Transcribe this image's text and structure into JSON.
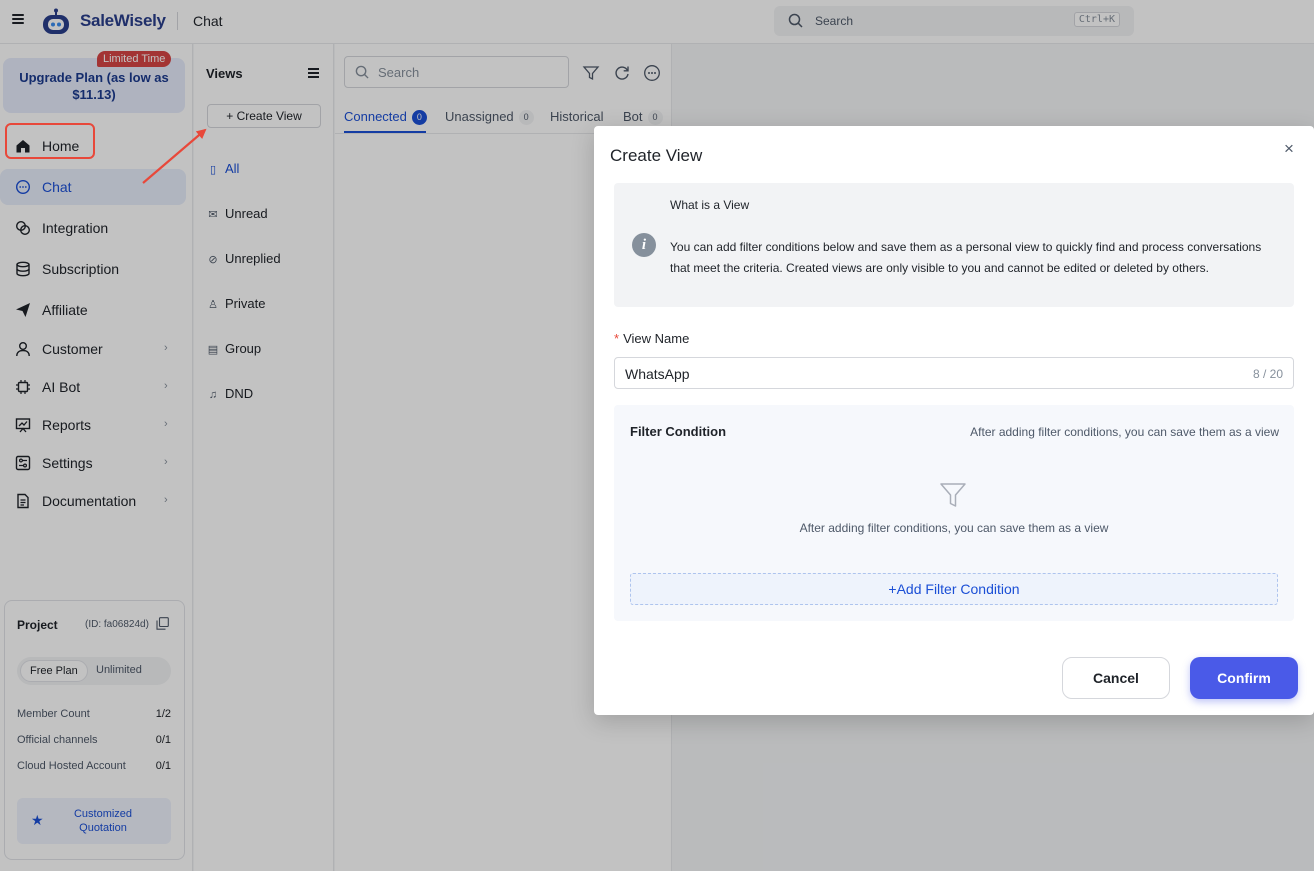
{
  "app": {
    "brand": "SaleWisely",
    "breadcrumb": "Chat",
    "search_placeholder": "Search",
    "search_shortcut": "Ctrl+K"
  },
  "sidebar": {
    "upgrade_label": "Upgrade Plan (as low as $11.13)",
    "limited_badge": "Limited Time",
    "items": [
      {
        "label": "Home",
        "icon": "home-icon",
        "active": false,
        "chevron": false
      },
      {
        "label": "Chat",
        "icon": "chat-bubble-icon",
        "active": true,
        "chevron": false
      },
      {
        "label": "Integration",
        "icon": "link-icon",
        "active": false,
        "chevron": false
      },
      {
        "label": "Subscription",
        "icon": "database-icon",
        "active": false,
        "chevron": false
      },
      {
        "label": "Affiliate",
        "icon": "paper-plane-icon",
        "active": false,
        "chevron": false
      },
      {
        "label": "Customer",
        "icon": "user-icon",
        "active": false,
        "chevron": true
      },
      {
        "label": "AI Bot",
        "icon": "chip-icon",
        "active": false,
        "chevron": true
      },
      {
        "label": "Reports",
        "icon": "chart-icon",
        "active": false,
        "chevron": true
      },
      {
        "label": "Settings",
        "icon": "settings-icon",
        "active": false,
        "chevron": true
      },
      {
        "label": "Documentation",
        "icon": "document-icon",
        "active": false,
        "chevron": true
      }
    ],
    "project": {
      "title": "Project",
      "id_text": "(ID: fa06824d)",
      "plan": "Free Plan",
      "plan_limit": "Unlimited",
      "stats": [
        {
          "label": "Member Count",
          "value": "1/2"
        },
        {
          "label": "Official channels",
          "value": "0/1"
        },
        {
          "label": "Cloud Hosted Account",
          "value": "0/1"
        }
      ],
      "quote_label": "Customized Quotation"
    }
  },
  "views": {
    "title": "Views",
    "create_label": "Create View",
    "items": [
      {
        "label": "All",
        "icon": "bookmark-icon",
        "active": true
      },
      {
        "label": "Unread",
        "icon": "envelope-icon",
        "active": false
      },
      {
        "label": "Unreplied",
        "icon": "eye-off-icon",
        "active": false
      },
      {
        "label": "Private",
        "icon": "user-icon",
        "active": false
      },
      {
        "label": "Group",
        "icon": "message-square-icon",
        "active": false
      },
      {
        "label": "DND",
        "icon": "bell-off-icon",
        "active": false
      }
    ]
  },
  "chat_list": {
    "search_placeholder": "Search",
    "tabs": [
      {
        "label": "Connected",
        "count": "0",
        "active": true
      },
      {
        "label": "Unassigned",
        "count": "0",
        "active": false
      },
      {
        "label": "Historical",
        "count": "",
        "active": false
      },
      {
        "label": "Bot",
        "count": "0",
        "active": false
      }
    ]
  },
  "modal": {
    "title": "Create View",
    "close": "×",
    "info_title": "What is a View",
    "info_text": "You can add filter conditions below and save them as a personal view to quickly find and process conversations that meet the criteria. Created views are only visible to you and cannot be edited or deleted by others.",
    "name_label": "View Name",
    "required_mark": "*",
    "name_value": "WhatsApp",
    "name_counter": "8 / 20",
    "filter_title": "Filter Condition",
    "filter_hint": "After adding filter conditions, you can save them as a view",
    "filter_empty": "After adding filter conditions, you can save them as a view",
    "add_condition": "+Add Filter Condition",
    "cancel": "Cancel",
    "confirm": "Confirm"
  },
  "colors": {
    "accent": "#1b4fd6",
    "confirm": "#4a5ae8",
    "annotation_red": "#e8483a"
  }
}
